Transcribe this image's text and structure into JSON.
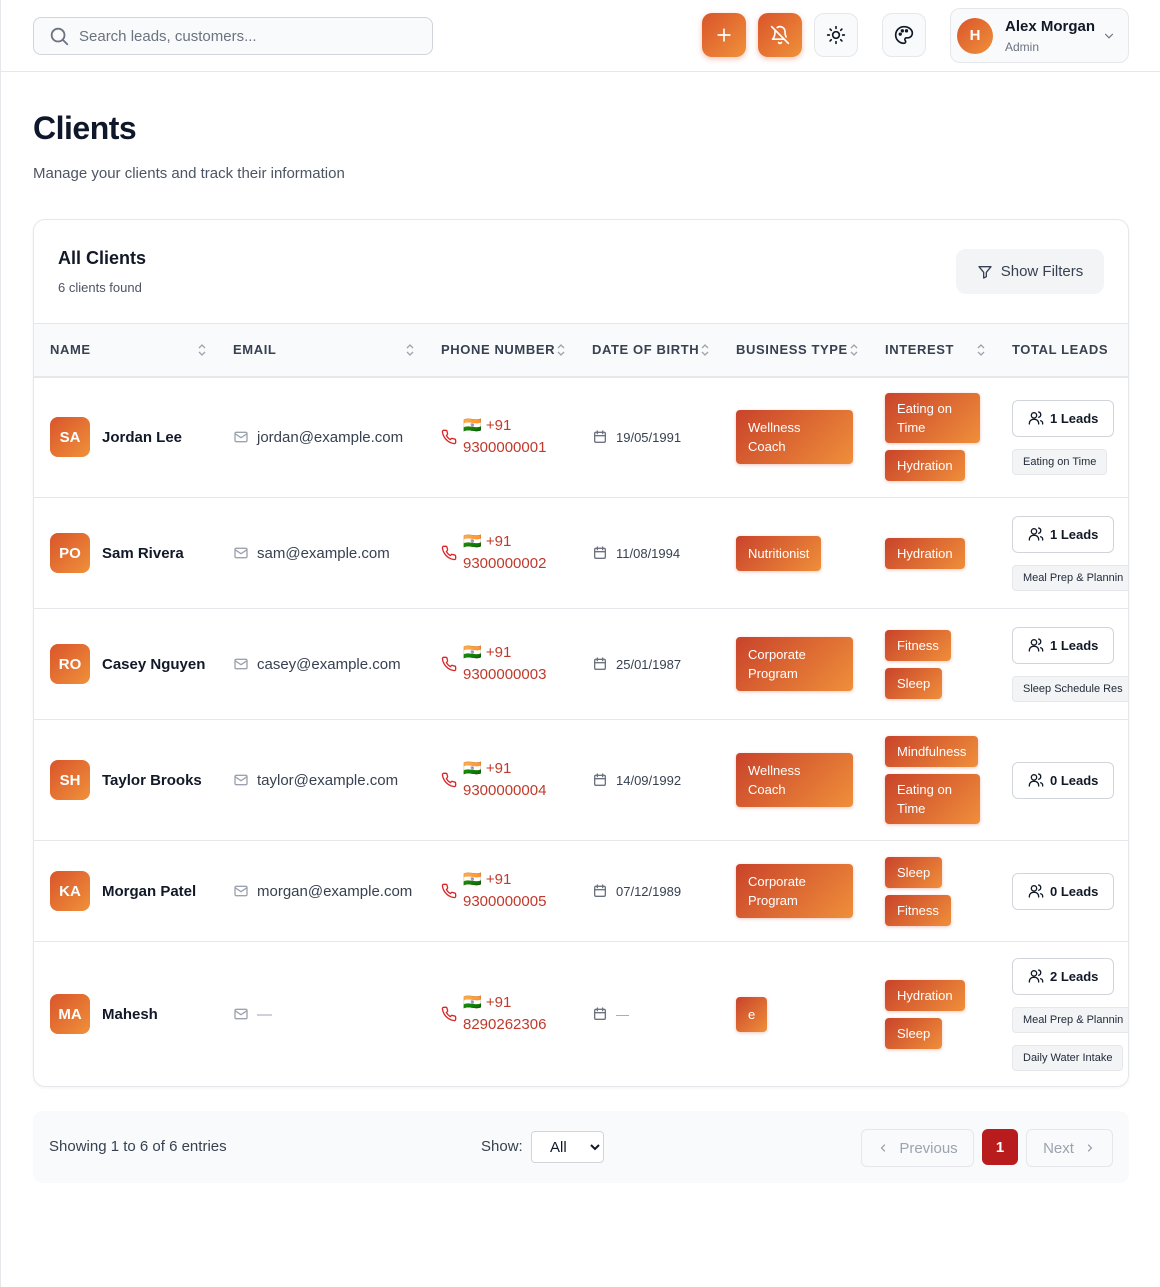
{
  "search": {
    "placeholder": "Search leads, customers..."
  },
  "user": {
    "initial": "H",
    "name": "Alex Morgan",
    "role": "Admin"
  },
  "page": {
    "title": "Clients",
    "subtitle": "Manage your clients and track their information"
  },
  "card": {
    "title": "All Clients",
    "count": "6 clients found",
    "filter_label": "Show Filters"
  },
  "columns": [
    "Name",
    "Email",
    "Phone Number",
    "Date of Birth",
    "Business Type",
    "Interest",
    "Total Leads"
  ],
  "clients": [
    {
      "initials": "SA",
      "name": "Jordan Lee",
      "email": "jordan@example.com",
      "phone_code": "🇮🇳 +91",
      "phone": "9300000001",
      "dob": "19/05/1991",
      "business": "Wellness Coach",
      "interests": [
        "Eating on Time",
        "Hydration"
      ],
      "leads": "1 Leads",
      "lead_tags": [
        "Eating on Time"
      ]
    },
    {
      "initials": "PO",
      "name": "Sam Rivera",
      "email": "sam@example.com",
      "phone_code": "🇮🇳 +91",
      "phone": "9300000002",
      "dob": "11/08/1994",
      "business": "Nutritionist",
      "interests": [
        "Hydration"
      ],
      "leads": "1 Leads",
      "lead_tags": [
        "Meal Prep & Plannin"
      ]
    },
    {
      "initials": "RO",
      "name": "Casey Nguyen",
      "email": "casey@example.com",
      "phone_code": "🇮🇳 +91",
      "phone": "9300000003",
      "dob": "25/01/1987",
      "business": "Corporate Program",
      "interests": [
        "Fitness",
        "Sleep"
      ],
      "leads": "1 Leads",
      "lead_tags": [
        "Sleep Schedule Res"
      ]
    },
    {
      "initials": "SH",
      "name": "Taylor Brooks",
      "email": "taylor@example.com",
      "phone_code": "🇮🇳 +91",
      "phone": "9300000004",
      "dob": "14/09/1992",
      "business": "Wellness Coach",
      "interests": [
        "Mindfulness",
        "Eating on Time"
      ],
      "leads": "0 Leads",
      "lead_tags": []
    },
    {
      "initials": "KA",
      "name": "Morgan Patel",
      "email": "morgan@example.com",
      "phone_code": "🇮🇳 +91",
      "phone": "9300000005",
      "dob": "07/12/1989",
      "business": "Corporate Program",
      "interests": [
        "Sleep",
        "Fitness"
      ],
      "leads": "0 Leads",
      "lead_tags": []
    },
    {
      "initials": "MA",
      "name": "Mahesh",
      "email": "—",
      "phone_code": "🇮🇳 +91",
      "phone": "8290262306",
      "dob": "—",
      "business": "e",
      "interests": [
        "Hydration",
        "Sleep"
      ],
      "leads": "2 Leads",
      "lead_tags": [
        "Meal Prep & Plannin",
        "Daily Water Intake"
      ]
    }
  ],
  "pagination": {
    "showing": "Showing 1 to 6 of 6 entries",
    "show_label": "Show:",
    "show_value": "All",
    "prev": "Previous",
    "next": "Next",
    "page": "1"
  },
  "colors": {
    "accent_start": "#d9542b",
    "accent_end": "#f0913a",
    "phone": "#c0392b",
    "page_active": "#b91c1c"
  },
  "icons": [
    "search-icon",
    "plus-icon",
    "bell-off-icon",
    "sun-icon",
    "palette-icon",
    "chevron-down-icon",
    "filter-icon",
    "mail-icon",
    "phone-icon",
    "calendar-icon",
    "users-icon",
    "sort-icon",
    "chevron-left-icon",
    "chevron-right-icon"
  ]
}
